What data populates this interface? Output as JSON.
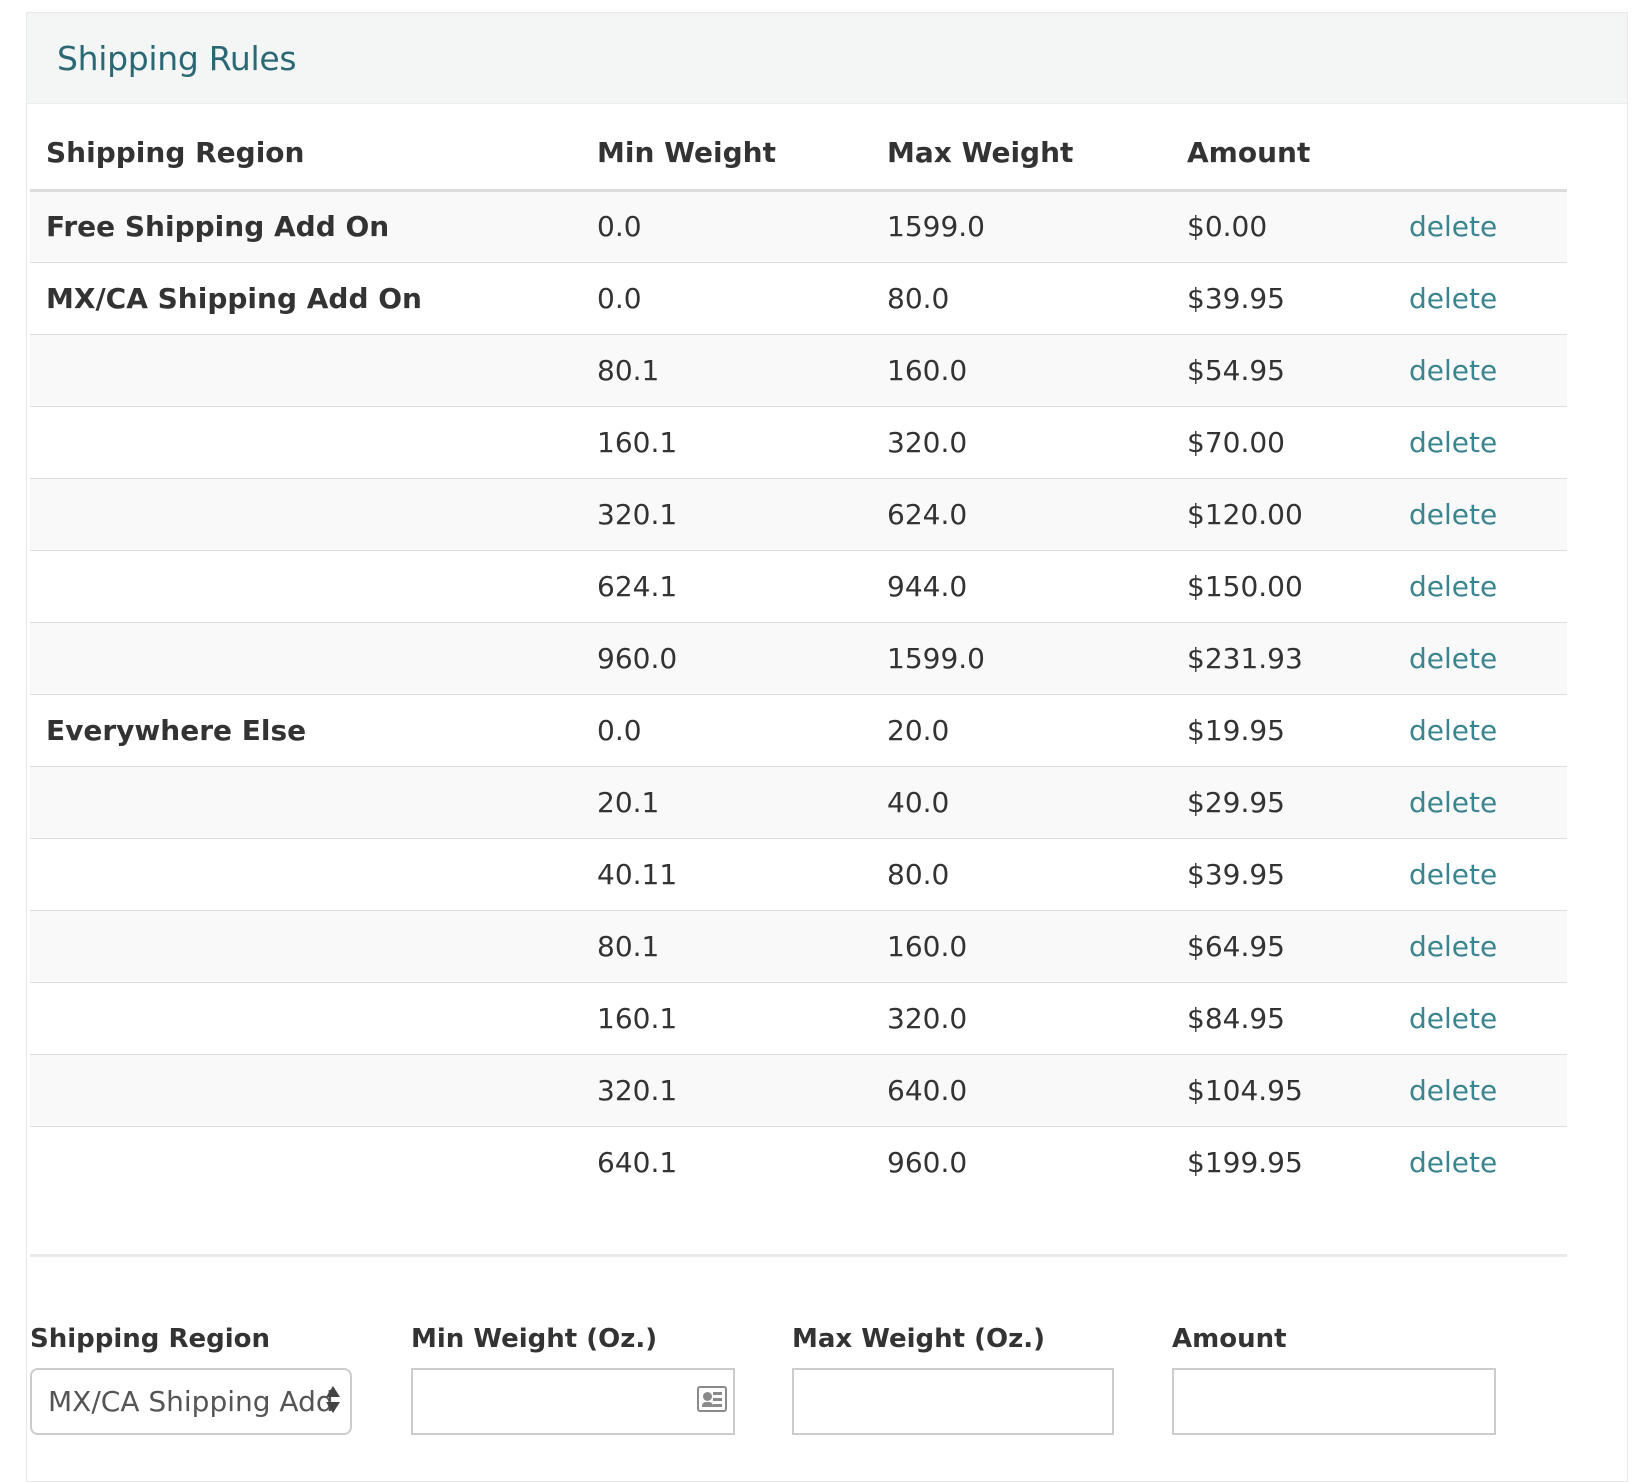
{
  "panel": {
    "title": "Shipping Rules"
  },
  "table": {
    "headers": {
      "region": "Shipping Region",
      "min_weight": "Min Weight",
      "max_weight": "Max Weight",
      "amount": "Amount"
    },
    "rows": [
      {
        "region": "Free Shipping Add On",
        "min": "0.0",
        "max": "1599.0",
        "amount": "$0.00",
        "action": "delete"
      },
      {
        "region": "MX/CA Shipping Add On",
        "min": "0.0",
        "max": "80.0",
        "amount": "$39.95",
        "action": "delete"
      },
      {
        "region": "",
        "min": "80.1",
        "max": "160.0",
        "amount": "$54.95",
        "action": "delete"
      },
      {
        "region": "",
        "min": "160.1",
        "max": "320.0",
        "amount": "$70.00",
        "action": "delete"
      },
      {
        "region": "",
        "min": "320.1",
        "max": "624.0",
        "amount": "$120.00",
        "action": "delete"
      },
      {
        "region": "",
        "min": "624.1",
        "max": "944.0",
        "amount": "$150.00",
        "action": "delete"
      },
      {
        "region": "",
        "min": "960.0",
        "max": "1599.0",
        "amount": "$231.93",
        "action": "delete"
      },
      {
        "region": "Everywhere Else",
        "min": "0.0",
        "max": "20.0",
        "amount": "$19.95",
        "action": "delete"
      },
      {
        "region": "",
        "min": "20.1",
        "max": "40.0",
        "amount": "$29.95",
        "action": "delete"
      },
      {
        "region": "",
        "min": "40.11",
        "max": "80.0",
        "amount": "$39.95",
        "action": "delete"
      },
      {
        "region": "",
        "min": "80.1",
        "max": "160.0",
        "amount": "$64.95",
        "action": "delete"
      },
      {
        "region": "",
        "min": "160.1",
        "max": "320.0",
        "amount": "$84.95",
        "action": "delete"
      },
      {
        "region": "",
        "min": "320.1",
        "max": "640.0",
        "amount": "$104.95",
        "action": "delete"
      },
      {
        "region": "",
        "min": "640.1",
        "max": "960.0",
        "amount": "$199.95",
        "action": "delete"
      }
    ]
  },
  "form": {
    "region_label": "Shipping Region",
    "region_selected": "MX/CA Shipping Add On",
    "min_label": "Min Weight (Oz.)",
    "min_value": "",
    "max_label": "Max Weight (Oz.)",
    "max_value": "",
    "amount_label": "Amount",
    "amount_value": ""
  },
  "icons": {
    "select_arrows": "sort-arrows-icon",
    "autofill": "contact-card-icon"
  },
  "colors": {
    "title": "#2a6875",
    "link": "#3a8590",
    "header_bg": "#f4f6f5",
    "stripe": "#f9f9f9"
  }
}
